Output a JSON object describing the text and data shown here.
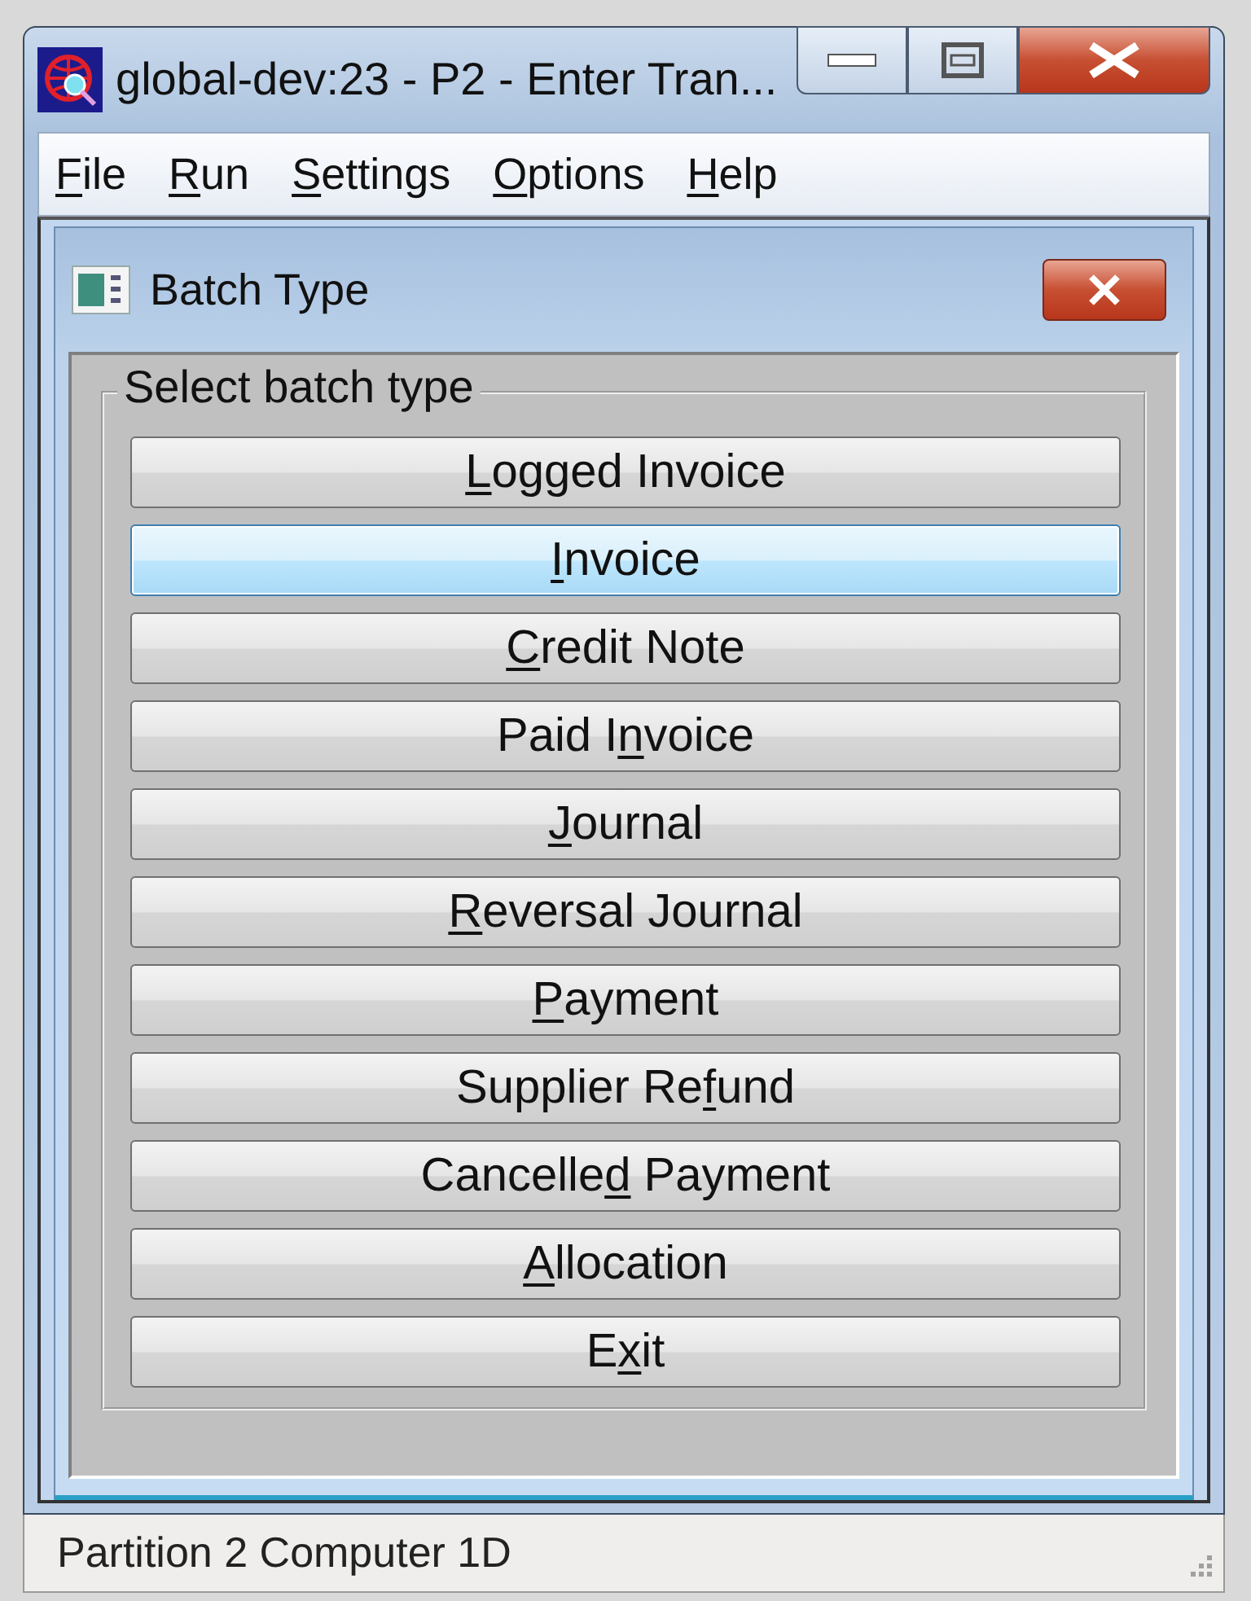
{
  "window": {
    "title": "global-dev:23 - P2 - Enter Tran...",
    "controls": [
      {
        "kind": "minimize"
      },
      {
        "kind": "maximize"
      },
      {
        "kind": "close"
      }
    ]
  },
  "menu": [
    {
      "key": "F",
      "post": "ile"
    },
    {
      "key": "R",
      "post": "un"
    },
    {
      "key": "S",
      "post": "ettings"
    },
    {
      "key": "O",
      "post": "ptions"
    },
    {
      "key": "H",
      "post": "elp"
    }
  ],
  "dialog": {
    "title": "Batch Type",
    "group_label": "Select batch type",
    "buttons": [
      {
        "key": "L",
        "post": "ogged Invoice",
        "focused": false
      },
      {
        "key": "I",
        "post": "nvoice",
        "focused": true
      },
      {
        "key": "C",
        "post": "redit Note",
        "focused": false
      },
      {
        "pre": "Paid I",
        "key": "n",
        "post": "voice",
        "focused": false
      },
      {
        "key": "J",
        "post": "ournal",
        "focused": false
      },
      {
        "key": "R",
        "post": "eversal Journal",
        "focused": false
      },
      {
        "key": "P",
        "post": "ayment",
        "focused": false
      },
      {
        "pre": "Supplier Re",
        "key": "f",
        "post": "und",
        "focused": false
      },
      {
        "pre": "Cancelle",
        "key": "d",
        "post": " Payment",
        "focused": false
      },
      {
        "key": "A",
        "post": "llocation",
        "focused": false
      },
      {
        "pre": "E",
        "key": "x",
        "post": "it",
        "focused": false
      }
    ]
  },
  "status_bar": {
    "text": "Partition 2 Computer 1D"
  }
}
